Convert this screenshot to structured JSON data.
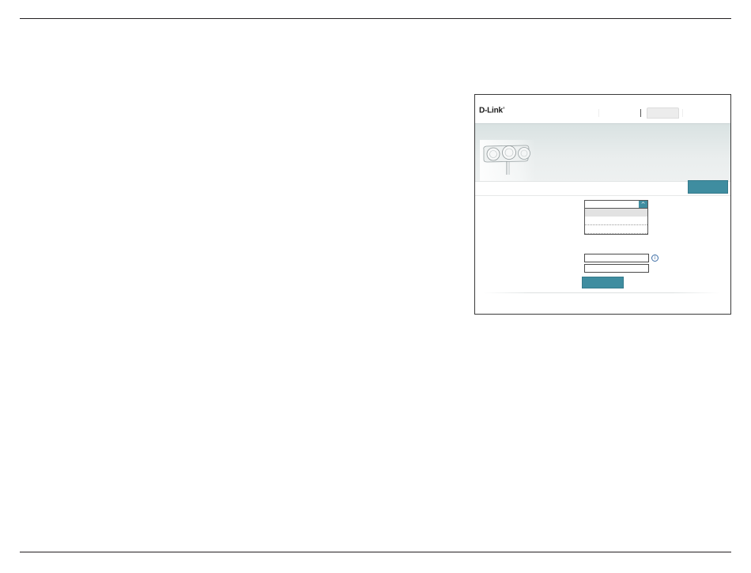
{
  "screenshot": {
    "logo": {
      "text": "D-Link",
      "reg": "®"
    },
    "dropdown": {
      "arrow_icon": "chevron-up-icon"
    },
    "info": {
      "icon": "info-icon",
      "glyph": "i"
    },
    "colors": {
      "accent": "#3f8da0",
      "banner": "#e6ebeb",
      "frame": "#3a3a3a"
    }
  }
}
